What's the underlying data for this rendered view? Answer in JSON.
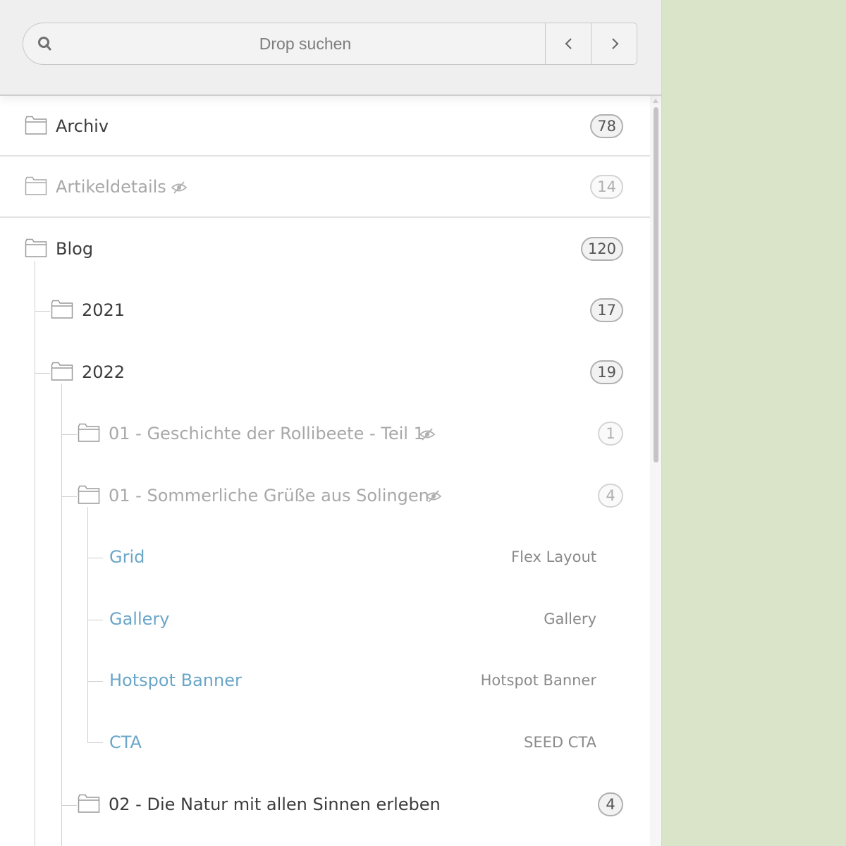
{
  "search": {
    "placeholder": "Drop suchen",
    "prev_icon": "chevron-left-icon",
    "next_icon": "chevron-right-icon",
    "search_icon": "search-icon"
  },
  "tree": {
    "folders": [
      {
        "label": "Archiv",
        "count": "78",
        "hidden": false
      },
      {
        "label": "Artikeldetails",
        "count": "14",
        "hidden": true
      },
      {
        "label": "Blog",
        "count": "120",
        "hidden": false
      },
      {
        "label": "2021",
        "count": "17",
        "hidden": false
      },
      {
        "label": "2022",
        "count": "19",
        "hidden": false
      },
      {
        "label": "01 - Geschichte der Rollibeete - Teil 1",
        "count": "1",
        "hidden": true
      },
      {
        "label": "01 - Sommerliche Grüße aus Solingen",
        "count": "4",
        "hidden": true
      },
      {
        "label": "02 - Die Natur mit allen Sinnen erleben",
        "count": "4",
        "hidden": false
      }
    ],
    "elements": [
      {
        "label": "Grid",
        "type": "Flex Layout"
      },
      {
        "label": "Gallery",
        "type": "Gallery"
      },
      {
        "label": "Hotspot Banner",
        "type": "Hotspot Banner"
      },
      {
        "label": "CTA",
        "type": "SEED CTA"
      }
    ]
  },
  "colors": {
    "element_link": "#6aa6c8",
    "background_right": "#d9e4c8",
    "header_bg": "#efefef"
  },
  "icons": {
    "folder": "folder-icon",
    "hidden": "eye-slash-icon"
  }
}
